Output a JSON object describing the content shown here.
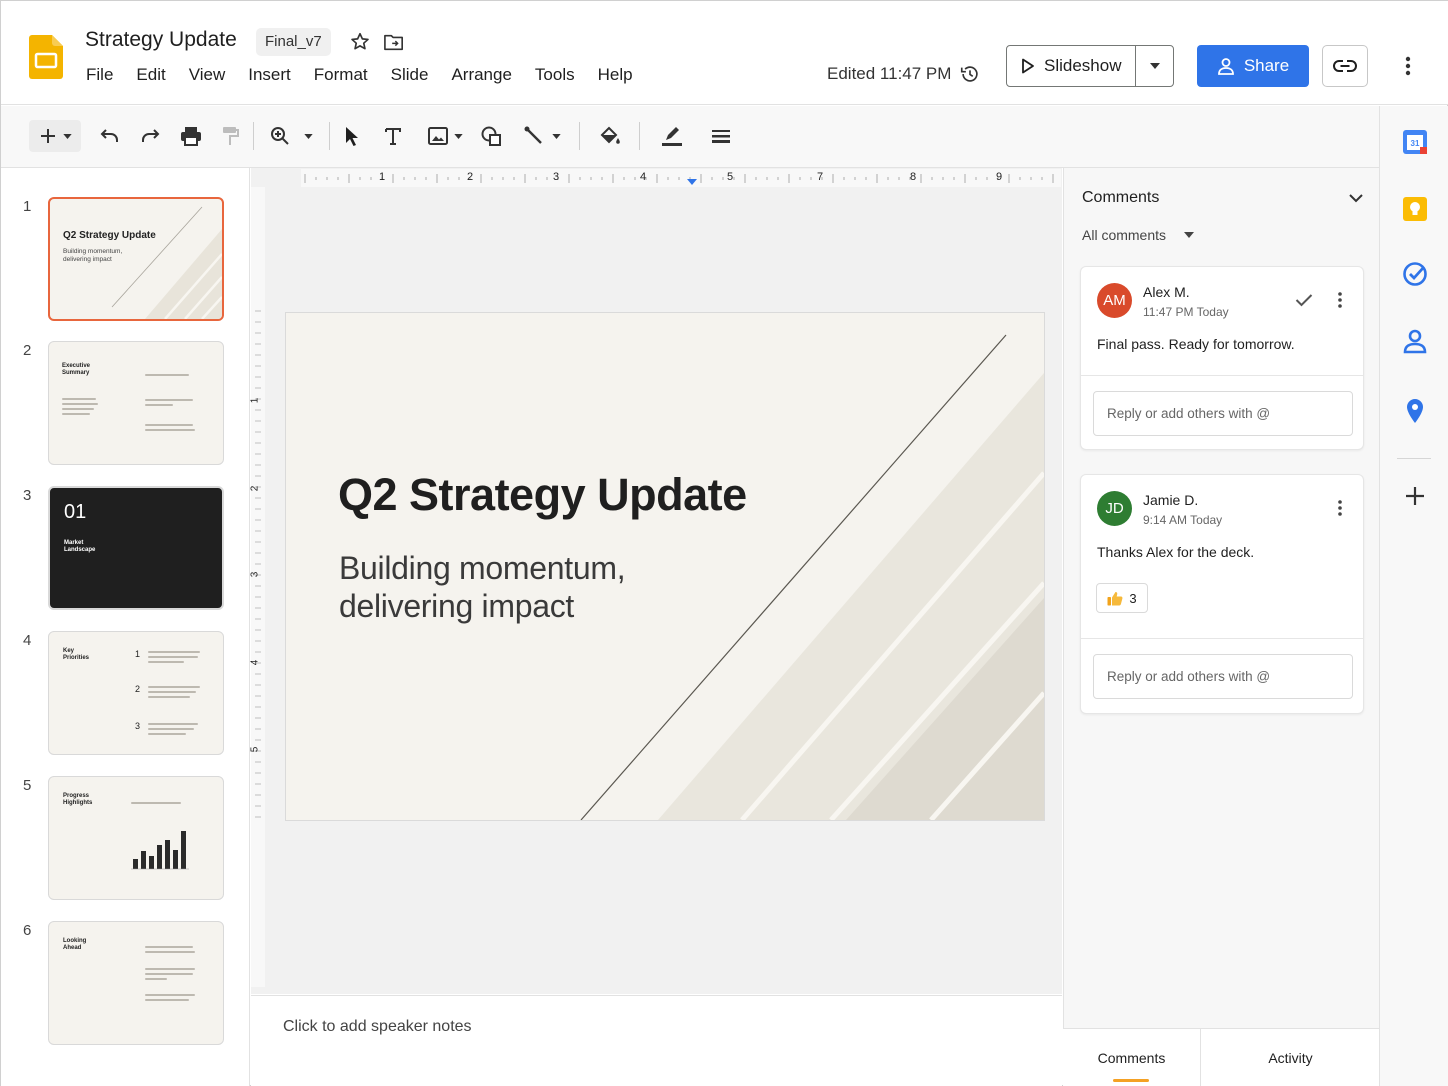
{
  "header": {
    "doc_title": "Strategy Update",
    "version_badge": "Final_v7",
    "menu": [
      "File",
      "Edit",
      "View",
      "Insert",
      "Format",
      "Slide",
      "Arrange",
      "Tools",
      "Help"
    ],
    "edited_status": "Edited 11:47 PM",
    "slideshow_label": "Slideshow",
    "share_label": "Share"
  },
  "filmstrip": {
    "slides": [
      {
        "number": "1",
        "title": "Q2 Strategy Update",
        "subtitle": "Building momentum, delivering impact"
      },
      {
        "number": "2",
        "title": "Executive Summary"
      },
      {
        "number": "3",
        "title": "01",
        "subtitle": "Market Landscape"
      },
      {
        "number": "4",
        "title": "Key Priorities",
        "items": [
          "1",
          "2",
          "3"
        ]
      },
      {
        "number": "5",
        "title": "Progress Highlights"
      },
      {
        "number": "6",
        "title": "Looking Ahead"
      }
    ]
  },
  "ruler": {
    "top_labels": [
      "1",
      "2",
      "3",
      "4",
      "5",
      "7",
      "8",
      "9"
    ],
    "left_labels": [
      "1",
      "2",
      "3",
      "4",
      "5"
    ]
  },
  "slide": {
    "title": "Q2 Strategy Update",
    "subtitle": "Building momentum, delivering impact"
  },
  "notes": {
    "placeholder": "Click to add speaker notes"
  },
  "comments": {
    "title": "Comments",
    "filter": "All comments",
    "items": [
      {
        "initials": "AM",
        "author": "Alex M.",
        "time": "11:47 PM Today",
        "text": "Final pass. Ready for tomorrow.",
        "avatar_color": "#d94a2b",
        "reply_placeholder": "Reply or add others with @"
      },
      {
        "initials": "JD",
        "author": "Jamie D.",
        "time": "9:14 AM Today",
        "text": "Thanks Alex for the deck.",
        "avatar_color": "#2e7d32",
        "reaction_count": "3",
        "reply_placeholder": "Reply or add others with @"
      }
    ],
    "tabs": [
      "Comments",
      "Activity"
    ]
  },
  "colors": {
    "accent": "#2f74e8",
    "selection": "#e8663d",
    "slides_yellow": "#f4b400"
  },
  "icons": {
    "rail": [
      "calendar-icon",
      "keep-icon",
      "tasks-icon",
      "contacts-icon",
      "maps-icon",
      "add-icon"
    ]
  }
}
